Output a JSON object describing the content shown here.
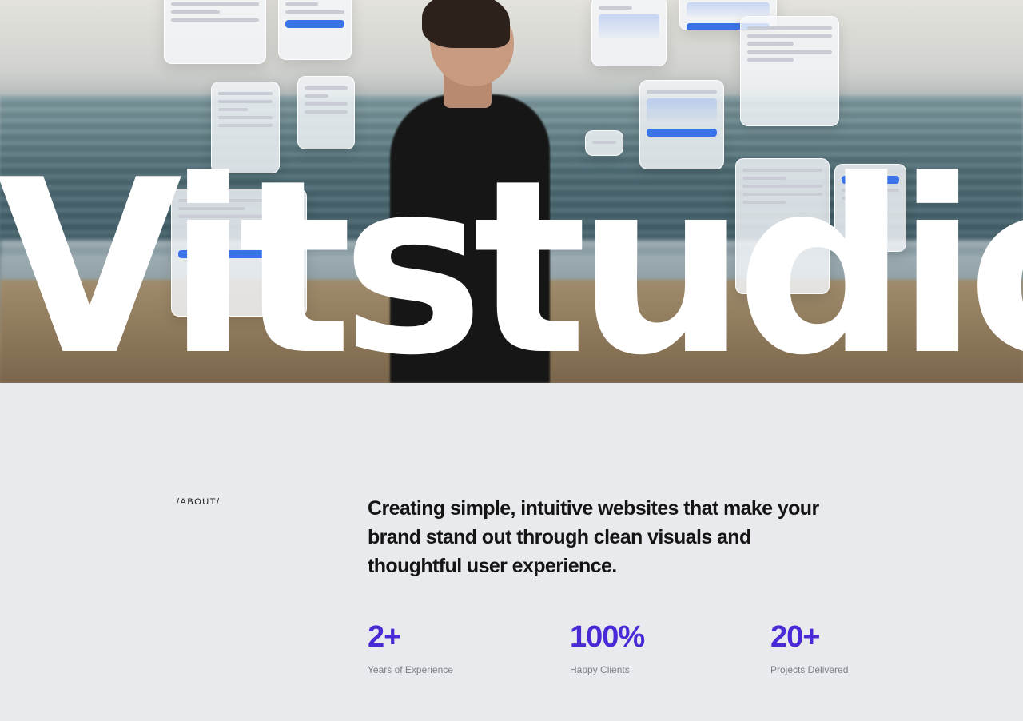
{
  "hero": {
    "brand_name": "Vitstudio"
  },
  "about": {
    "label": "/ABOUT/",
    "headline": "Creating simple, intuitive websites that make your brand stand out through clean visuals and thoughtful user experience.",
    "stats": [
      {
        "value": "2+",
        "label": "Years of Experience"
      },
      {
        "value": "100%",
        "label": "Happy Clients"
      },
      {
        "value": "20+",
        "label": "Projects Delivered"
      }
    ]
  },
  "colors": {
    "accent": "#4a2ad6",
    "background": "#e9eaee",
    "text": "#141414"
  }
}
